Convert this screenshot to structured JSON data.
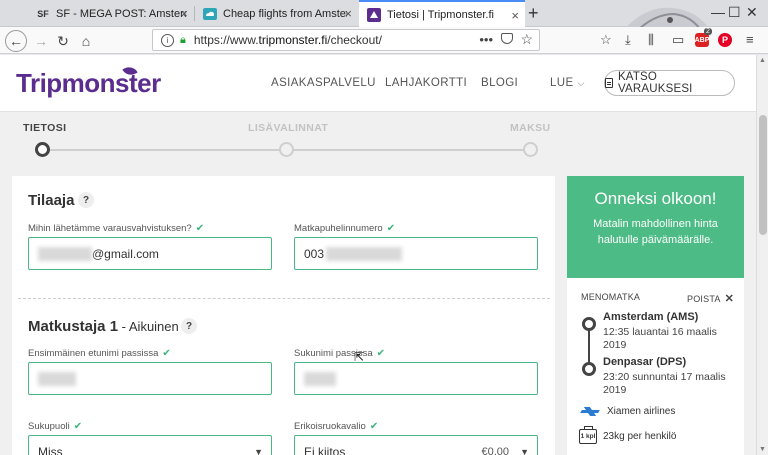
{
  "browser": {
    "tabs": [
      {
        "favicon": "SF",
        "title": "SF - MEGA POST: Amsterdam, Net"
      },
      {
        "favicon": "cloud-favicon",
        "title": "Cheap flights from Amsterdam"
      },
      {
        "favicon": "tripmonster-favicon",
        "title": "Tietosi | Tripmonster.fi"
      }
    ],
    "url_scheme": "https://www.",
    "url_host": "tripmonster.fi",
    "url_path": "/checkout/",
    "abp_badge": "2",
    "abp_label": "ABP",
    "pinterest_label": "P"
  },
  "site": {
    "logo": "Tripmonster",
    "menu": [
      "ASIAKASPALVELU",
      "LAHJAKORTTI",
      "BLOGI",
      "LUE"
    ],
    "booking_button": "KATSO VARAUKSESI"
  },
  "steps": [
    "TIETOSI",
    "LISÄVALINNAT",
    "MAKSU"
  ],
  "form": {
    "orderer_title": "Tilaaja",
    "email_label": "Mihin lähetämme varausvahvistuksen?",
    "email_value": "@gmail.com",
    "phone_label": "Matkapuhelinnumero",
    "phone_prefix": "003",
    "traveller_title": "Matkustaja 1",
    "traveller_sub": " - Aikuinen",
    "firstname_label": "Ensimmäinen etunimi passissa",
    "lastname_label": "Sukunimi passissa",
    "gender_label": "Sukupuoli",
    "gender_value": "Miss",
    "diet_label": "Erikoisruokavalio",
    "diet_value": "Ei kiitos",
    "diet_price": "€0,00",
    "help": "?"
  },
  "summary": {
    "congrats_title": "Onneksi olkoon!",
    "congrats_text": "Matalin mahdollinen hinta halutulle päivämäärälle.",
    "leg_label": "MENOMATKA",
    "remove_label": "POISTA",
    "departure_name": "Amsterdam (AMS)",
    "departure_time": "12:35 lauantai 16 maalis 2019",
    "arrival_name": "Denpasar (DPS)",
    "arrival_time": "23:20 sunnuntai 17 maalis 2019",
    "airline": "Xiamen airlines",
    "bag_label": "1 kpl",
    "bag_text": "23kg per henkilö"
  },
  "colors": {
    "brand": "#5b2d8e",
    "accent_green": "#4cbb85",
    "tab_active": "#4a8cf7"
  }
}
